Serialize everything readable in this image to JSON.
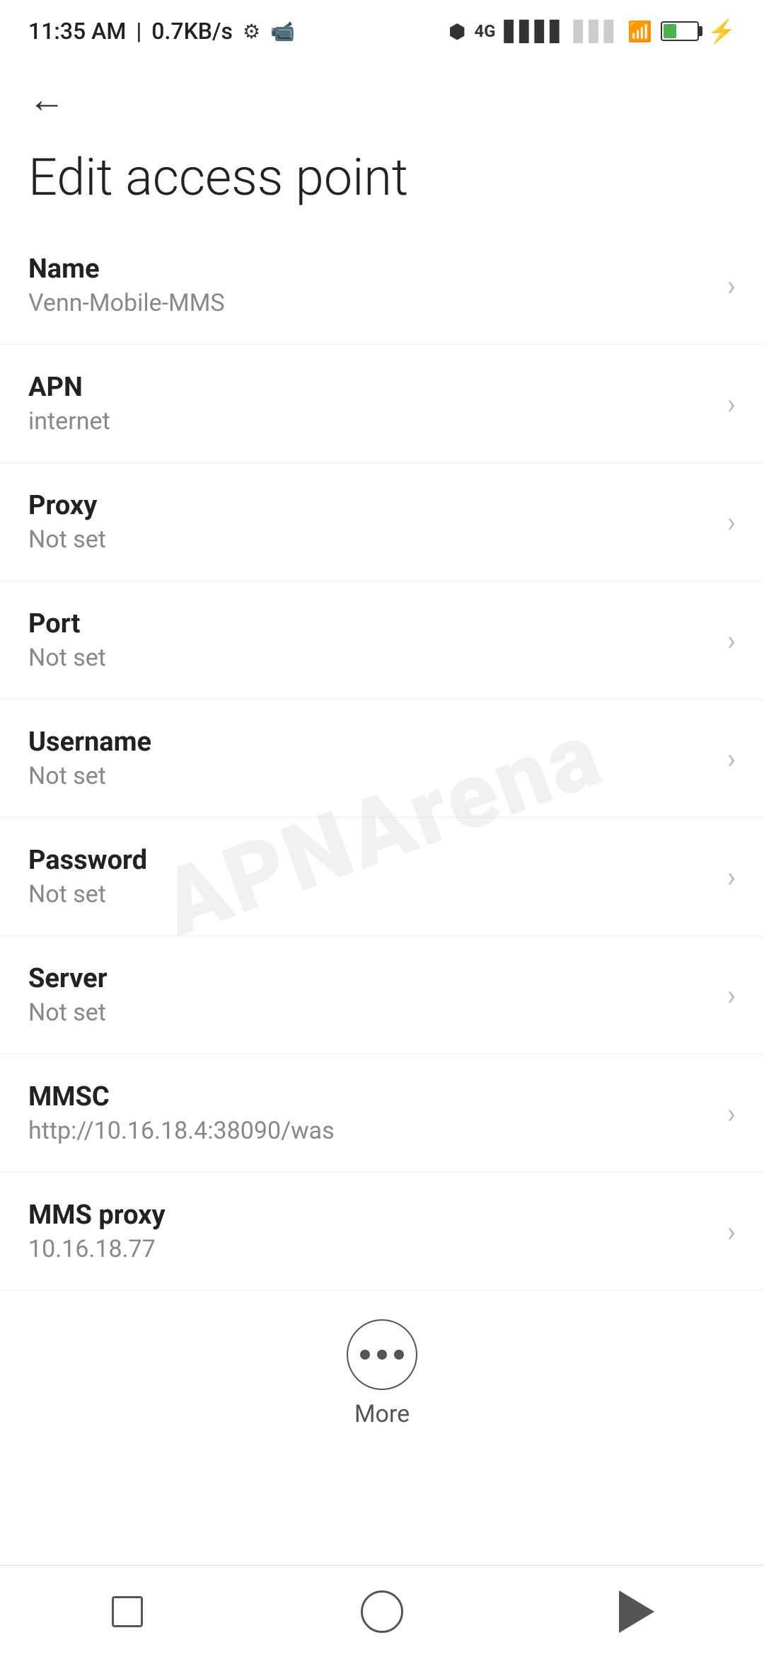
{
  "statusBar": {
    "time": "11:35 AM",
    "speed": "0.7KB/s"
  },
  "page": {
    "title": "Edit access point",
    "backLabel": "←"
  },
  "settings": [
    {
      "id": "name",
      "label": "Name",
      "value": "Venn-Mobile-MMS"
    },
    {
      "id": "apn",
      "label": "APN",
      "value": "internet"
    },
    {
      "id": "proxy",
      "label": "Proxy",
      "value": "Not set"
    },
    {
      "id": "port",
      "label": "Port",
      "value": "Not set"
    },
    {
      "id": "username",
      "label": "Username",
      "value": "Not set"
    },
    {
      "id": "password",
      "label": "Password",
      "value": "Not set"
    },
    {
      "id": "server",
      "label": "Server",
      "value": "Not set"
    },
    {
      "id": "mmsc",
      "label": "MMSC",
      "value": "http://10.16.18.4:38090/was"
    },
    {
      "id": "mms-proxy",
      "label": "MMS proxy",
      "value": "10.16.18.77"
    }
  ],
  "more": {
    "label": "More"
  },
  "watermark": "APNArena"
}
